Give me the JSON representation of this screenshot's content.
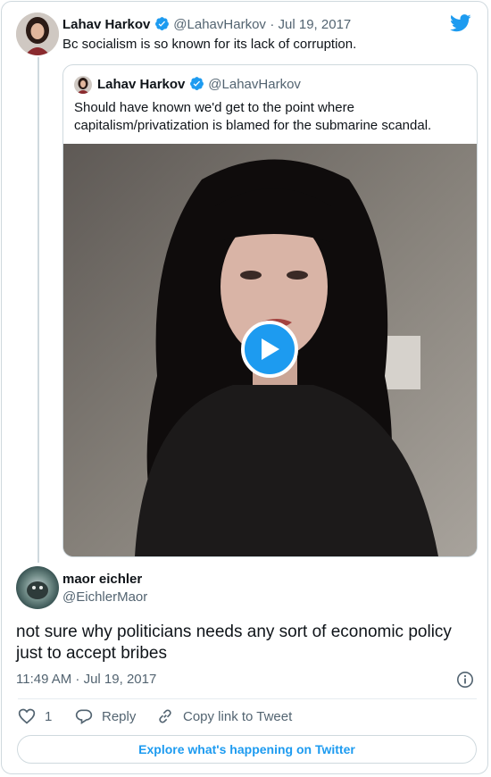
{
  "tweet": {
    "author_name": "Lahav Harkov",
    "author_handle": "@LahavHarkov",
    "separator_date": "· Jul 19, 2017",
    "text": "Bc socialism is so known for its lack of corruption."
  },
  "quoted_tweet": {
    "author_name": "Lahav Harkov",
    "author_handle": "@LahavHarkov",
    "text": "Should have known we'd get to the point where capitalism/privatization is blamed for the submarine scandal."
  },
  "reply": {
    "author_name": "maor eichler",
    "author_handle": "@EichlerMaor",
    "text": "not sure why politicians needs any sort of economic policy just to accept bribes",
    "timestamp": "11:49 AM · Jul 19, 2017"
  },
  "actions": {
    "like_count": "1",
    "reply_label": "Reply",
    "copy_link_label": "Copy link to Tweet"
  },
  "explore_label": "Explore what's happening on Twitter",
  "colors": {
    "brand": "#1d9bf0",
    "text": "#0f1419",
    "muted": "#536471",
    "border": "#cfd9de"
  },
  "icons": [
    "twitter-logo-icon",
    "verified-badge-icon",
    "play-icon",
    "heart-icon",
    "reply-icon",
    "link-icon",
    "info-icon"
  ]
}
